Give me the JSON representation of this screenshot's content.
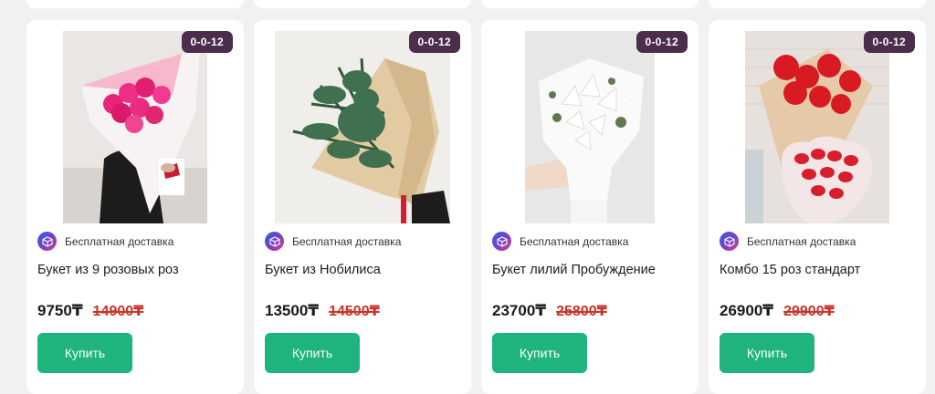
{
  "products": [
    {
      "badge": "0-0-12",
      "delivery": "Бесплатная доставка",
      "title": "Букет из 9 розовых роз",
      "price": "9750₸",
      "old_price": "14900₸",
      "buy_label": "Купить",
      "image": "pink-roses-bouquet"
    },
    {
      "badge": "0-0-12",
      "delivery": "Бесплатная доставка",
      "title": "Букет из Нобилиса",
      "price": "13500₸",
      "old_price": "14500₸",
      "buy_label": "Купить",
      "image": "nobilis-fir-bouquet"
    },
    {
      "badge": "0-0-12",
      "delivery": "Бесплатная доставка",
      "title": "Букет лилий Пробуждение",
      "price": "23700₸",
      "old_price": "25800₸",
      "buy_label": "Купить",
      "image": "white-lilies-bouquet"
    },
    {
      "badge": "0-0-12",
      "delivery": "Бесплатная доставка",
      "title": "Комбо 15 роз стандарт",
      "price": "26900₸",
      "old_price": "29900₸",
      "buy_label": "Купить",
      "image": "red-roses-kinder-combo"
    }
  ],
  "colors": {
    "badge_bg": "#4c2d4b",
    "buy_button": "#1fb37e",
    "old_price": "#c9352b"
  }
}
